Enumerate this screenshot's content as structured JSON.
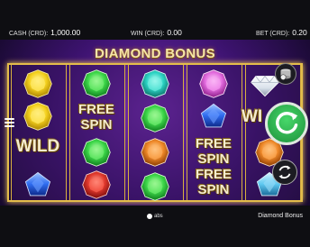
{
  "topbar": {
    "cash_label": "CASH (CRD):",
    "cash_value": "1,000.00",
    "win_label": "WIN (CRD):",
    "win_value": "0.00",
    "bet_label": "BET (CRD):",
    "bet_value": "0.20"
  },
  "title": "DIAMOND BONUS",
  "reels": {
    "r1": {
      "wild": "WILD"
    },
    "r2": {
      "free": "FREE",
      "spin": "SPIN"
    },
    "r4": {
      "free1": "FREE",
      "spin1": "SPIN",
      "free2": "FREE",
      "spin2": "SPIN"
    },
    "r5": {
      "wild_partial": "WI"
    }
  },
  "footer": {
    "logo_text": "abs",
    "game_name": "Diamond Bonus"
  },
  "colors": {
    "frame": "#e3bc4b",
    "spin_button": "#2fbf52",
    "yellow_gem": "#f5d21f",
    "green_gem": "#3ed84a",
    "teal_gem": "#2dd4c4",
    "blue_gem": "#2f6cf0",
    "red_gem": "#e23a2e",
    "orange_gem": "#f08a2a",
    "pink_gem": "#e46ee0",
    "white_diamond": "#e8eef5",
    "cyan_gem": "#5ec8f0"
  }
}
